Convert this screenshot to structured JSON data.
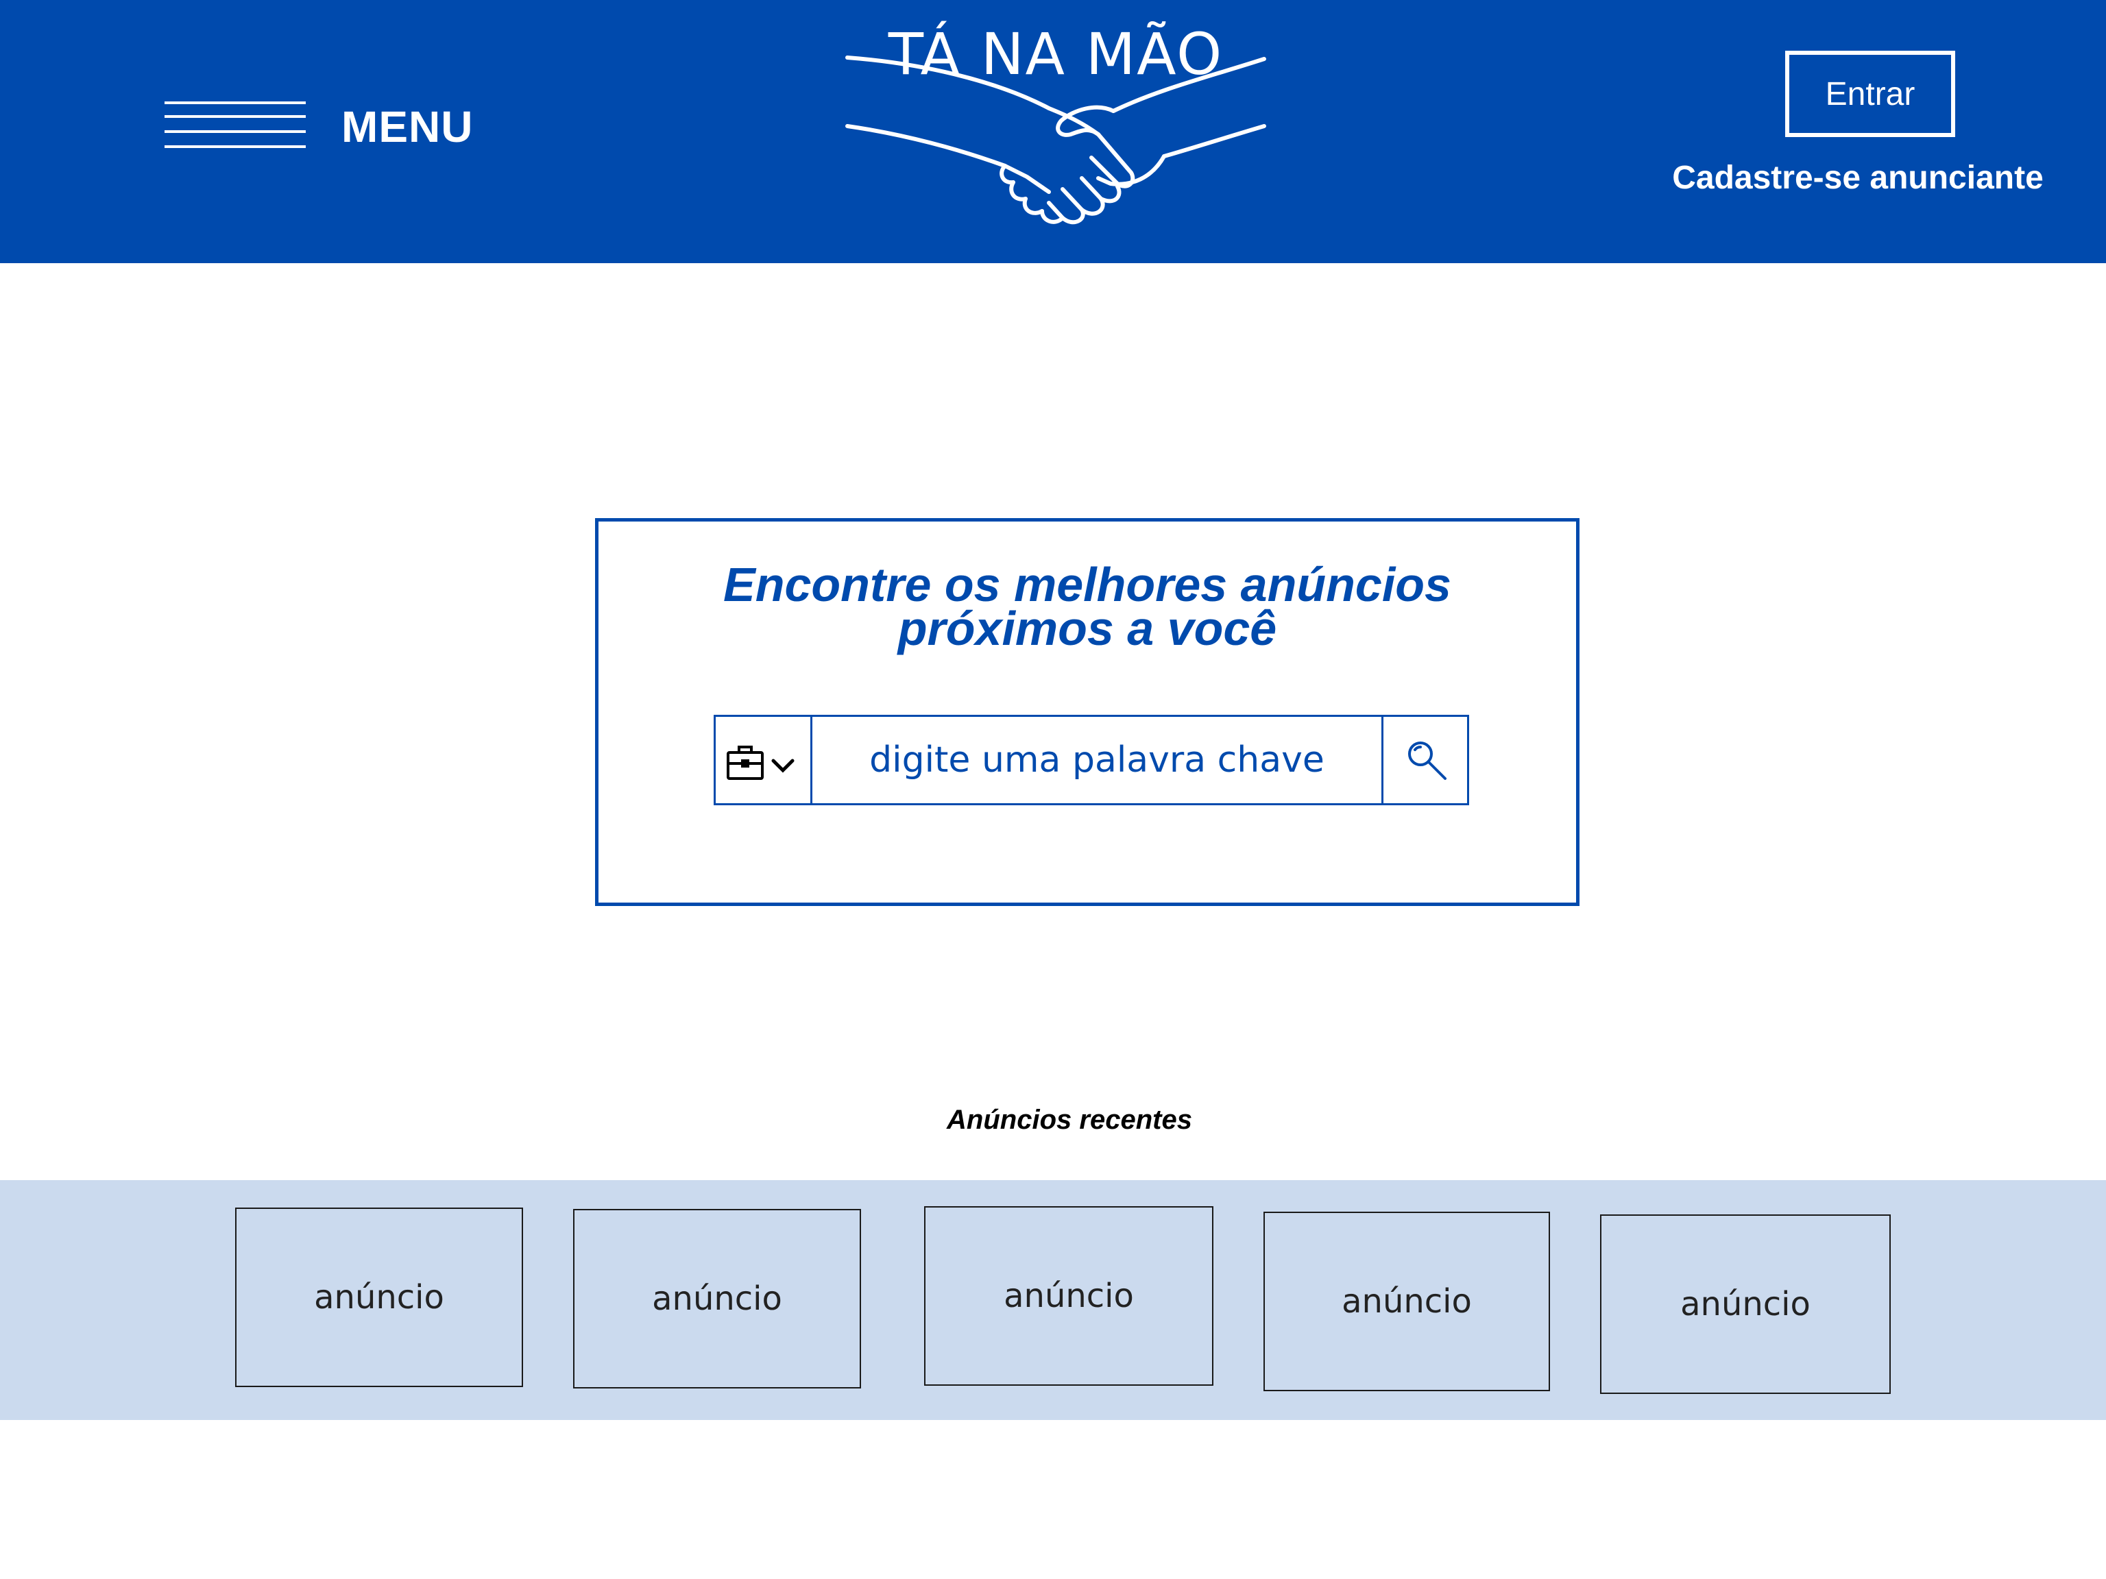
{
  "header": {
    "menu_label": "MENU",
    "logo_title": "TÁ NA MÃO",
    "login_button": "Entrar",
    "signup_link": "Cadastre-se anunciante",
    "background_color": "#004aad"
  },
  "search": {
    "title_line1": "Encontre os melhores anúncios",
    "title_line2": "próximos a você",
    "placeholder": "digite uma palavra chave",
    "category_icon": "briefcase-icon",
    "button_icon": "search-icon",
    "accent_color": "#004aad"
  },
  "recent": {
    "title": "Anúncios recentes",
    "strip_color": "#cbdaee",
    "ads": [
      {
        "label": "anúncio"
      },
      {
        "label": "anúncio"
      },
      {
        "label": "anúncio"
      },
      {
        "label": "anúncio"
      },
      {
        "label": "anúncio"
      }
    ]
  }
}
